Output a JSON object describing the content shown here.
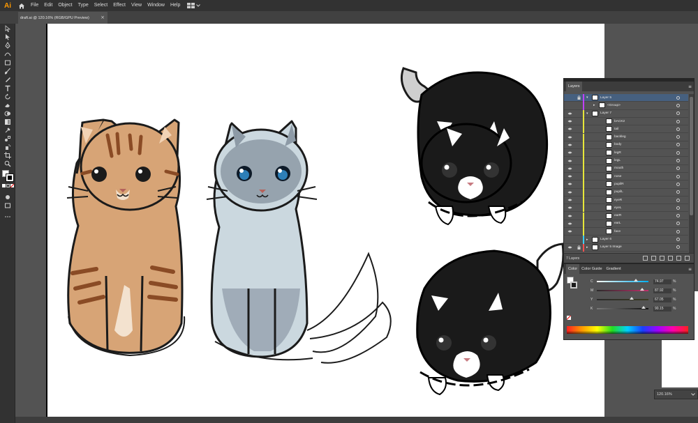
{
  "app": {
    "logo_text": "Ai",
    "brand_color": "#ff9a00"
  },
  "menu": {
    "items": [
      "File",
      "Edit",
      "Object",
      "Type",
      "Select",
      "Effect",
      "View",
      "Window",
      "Help"
    ],
    "layout_icon": "workspace-grid-icon"
  },
  "document_tab": {
    "title": "draft.ai @ 120.16% (RGB/GPU Preview)",
    "close": "×"
  },
  "tools": [
    "selection-tool",
    "direct-selection-tool",
    "pen-tool",
    "curvature-tool",
    "rectangle-tool",
    "paintbrush-tool",
    "pencil-tool",
    "type-tool",
    "rotate-tool",
    "eraser-tool",
    "shape-builder-tool",
    "gradient-tool",
    "eyedropper-tool",
    "blend-tool",
    "symbol-sprayer-tool",
    "artboard-tool",
    "zoom-tool"
  ],
  "layers_panel": {
    "tab": "Layers",
    "rows": [
      {
        "name": "Layer 5",
        "level": 0,
        "expanded": true,
        "color": "#c040ff",
        "selected": true,
        "locked": true,
        "eye": false
      },
      {
        "name": "<Group>",
        "level": 1,
        "expanded": false,
        "color": "#c040ff",
        "selected": false,
        "locked": false,
        "eye": false
      },
      {
        "name": "Layer 7",
        "level": 0,
        "expanded": true,
        "color": "#e7e73a",
        "selected": false,
        "locked": false,
        "eye": true
      },
      {
        "name": "bACK2",
        "level": 2,
        "color": "#e7e73a",
        "eye": true
      },
      {
        "name": "tail",
        "level": 2,
        "color": "#e7e73a",
        "eye": true
      },
      {
        "name": "backleg",
        "level": 2,
        "color": "#e7e73a",
        "eye": true
      },
      {
        "name": "body",
        "level": 2,
        "color": "#e7e73a",
        "eye": true
      },
      {
        "name": "legR",
        "level": 2,
        "color": "#e7e73a",
        "eye": true
      },
      {
        "name": "legL",
        "level": 2,
        "color": "#e7e73a",
        "eye": true
      },
      {
        "name": "mouth",
        "level": 2,
        "color": "#e7e73a",
        "eye": true
      },
      {
        "name": "nose",
        "level": 2,
        "color": "#e7e73a",
        "eye": true
      },
      {
        "name": "pupilR",
        "level": 2,
        "color": "#e7e73a",
        "eye": true
      },
      {
        "name": "pupilL",
        "level": 2,
        "color": "#e7e73a",
        "eye": true
      },
      {
        "name": "eyeR",
        "level": 2,
        "color": "#e7e73a",
        "eye": true
      },
      {
        "name": "eyeL",
        "level": 2,
        "color": "#e7e73a",
        "eye": true
      },
      {
        "name": "earR",
        "level": 2,
        "color": "#e7e73a",
        "eye": true
      },
      {
        "name": "earL",
        "level": 2,
        "color": "#e7e73a",
        "eye": true
      },
      {
        "name": "face",
        "level": 2,
        "color": "#e7e73a",
        "eye": true
      },
      {
        "name": "Layer 6",
        "level": 0,
        "expanded": false,
        "color": "#3ad0ff",
        "eye": false
      },
      {
        "name": "Layer 5 Image",
        "level": 0,
        "expanded": false,
        "color": "#ff5050",
        "eye": true,
        "locked": true
      }
    ],
    "count_label": "7 Layers"
  },
  "color_panel": {
    "tabs": [
      "Color",
      "Color Guide",
      "Gradient"
    ],
    "sliders": [
      {
        "label": "C",
        "value": "74.97",
        "fraction": 0.75,
        "gradient": "linear-gradient(to right,#fff,#00aeef)"
      },
      {
        "label": "M",
        "value": "87.92",
        "fraction": 0.88,
        "gradient": "linear-gradient(to right,#2a2a2a,#c0306a)"
      },
      {
        "label": "Y",
        "value": "67.05",
        "fraction": 0.67,
        "gradient": "linear-gradient(to right,#2a2a2a,#3a3a20)"
      },
      {
        "label": "K",
        "value": "90.15",
        "fraction": 0.9,
        "gradient": "linear-gradient(to right,#777,#111)"
      }
    ],
    "unit": "%"
  },
  "status": {
    "zoom": "120.16%"
  },
  "colors": {
    "fur_orange": "#d7a476",
    "fur_grey": "#cbd8df",
    "tuxedo": "#1a1a1a"
  }
}
